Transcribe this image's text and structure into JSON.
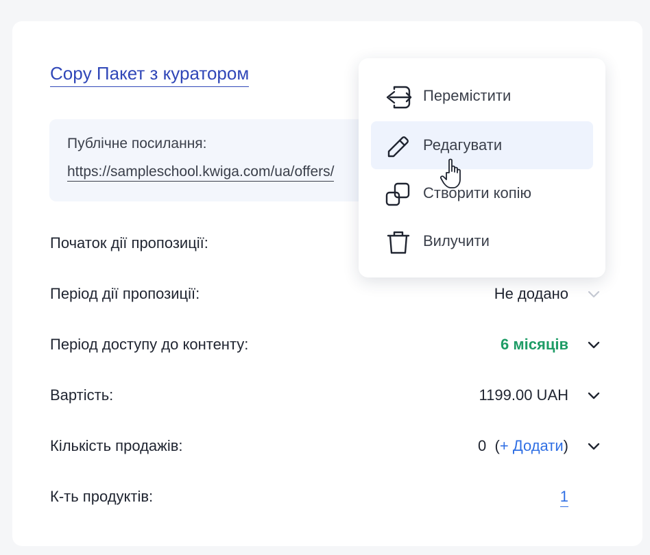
{
  "offer": {
    "title": "Copy Пакет з куратором",
    "public_label": "Публічне посилання:",
    "public_link": "https://sampleschool.kwiga.com/ua/offers/"
  },
  "rows": [
    {
      "label": "Початок дії пропозиції:",
      "value": "",
      "chevron": false
    },
    {
      "label": "Період дії пропозиції:",
      "value": "Не додано",
      "chevron": true,
      "chevron_muted": true
    },
    {
      "label": "Період доступу до контенту:",
      "value": "6 місяців",
      "chevron": true,
      "value_color": "#1e9c66"
    },
    {
      "label": "Вартість:",
      "value": "1199.00 UAH",
      "chevron": true
    },
    {
      "label": "Кількість продажів:",
      "count": "0",
      "add_label": "+ Додати",
      "paren_open": "(",
      "paren_close": ")",
      "chevron": true
    },
    {
      "label": "К-ть продуктів:",
      "value": "1",
      "chevron": false
    }
  ],
  "menu": {
    "items": [
      {
        "label": "Перемістити",
        "icon": "move-icon"
      },
      {
        "label": "Редагувати",
        "icon": "pencil-icon",
        "active": true
      },
      {
        "label": "Створити копію",
        "icon": "copy-icon"
      },
      {
        "label": "Вилучити",
        "icon": "trash-icon"
      }
    ]
  },
  "colors": {
    "accent": "#3047b8",
    "link": "#2f6fe4",
    "success": "#1e9c66",
    "menu_hover": "#eef3fd"
  }
}
